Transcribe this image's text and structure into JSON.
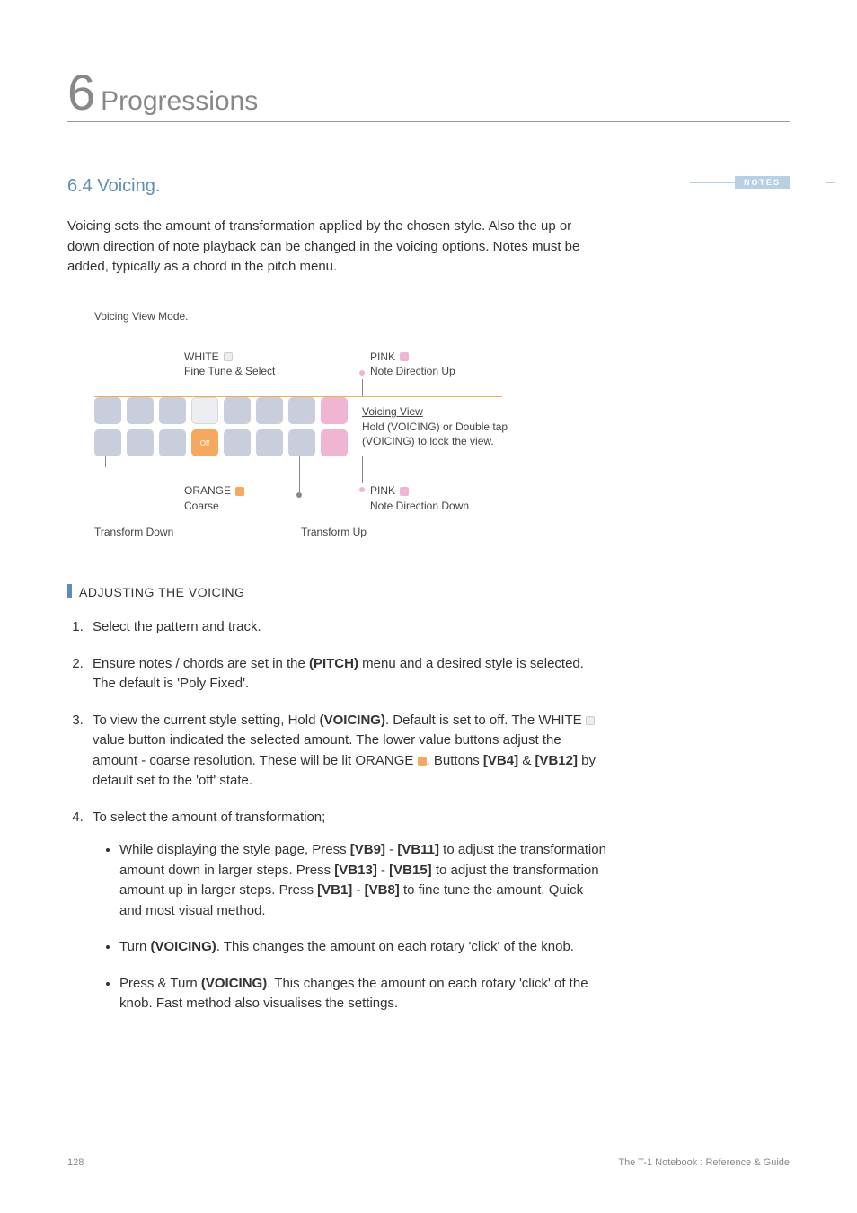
{
  "chapter": {
    "number": "6",
    "title": "Progressions"
  },
  "section": {
    "number_title": "6.4 Voicing."
  },
  "notes_label": "NOTES",
  "intro": "Voicing sets the amount of transformation applied by the chosen style. Also the up or down direction of note playback can be changed in the voicing options. Notes must be added, typically as a chord in the pitch menu.",
  "diagram": {
    "title": "Voicing View Mode.",
    "labels": {
      "white_title": "WHITE",
      "white_sub": "Fine Tune & Select",
      "pink_up_title": "PINK",
      "pink_up_sub": "Note Direction Up",
      "pink_dn_title": "PINK",
      "pink_dn_sub": "Note Direction Down",
      "orange_title": "ORANGE",
      "orange_sub": "Coarse",
      "voicing_view": "Voicing View",
      "voicing_view_sub": "Hold (VOICING) or Double tap (VOICING) to lock the view.",
      "transform_down": "Transform Down",
      "transform_up": "Transform Up",
      "off": "Off"
    },
    "colors": {
      "white": "#eceef2",
      "orange": "#f5a85e",
      "pink": "#efb6d4",
      "grey": "#c8cedc"
    }
  },
  "subheading": "ADJUSTING THE VOICING",
  "steps": {
    "s1": "Select the pattern and track.",
    "s2a": "Ensure notes / chords are set in the ",
    "s2b": "(PITCH)",
    "s2c": " menu and a desired style is selected. The default is 'Poly Fixed'.",
    "s3a": "To view the current style setting, Hold ",
    "s3b": "(VOICING)",
    "s3c": ".  Default is set to off. The WHITE ",
    "s3d": " value button indicated the selected amount. The lower value buttons adjust the amount - coarse resolution. These will be lit ORANGE ",
    "s3e": ". Buttons ",
    "s3f": "[VB4]",
    "s3g": " & ",
    "s3h": "[VB12]",
    "s3i": " by default set to the 'off' state.",
    "s4": "To select the amount of transformation;",
    "s4_1a": "While displaying the style page, Press ",
    "s4_1b": "[VB9]",
    "s4_1c": " - ",
    "s4_1d": "[VB11]",
    "s4_1e": " to adjust the transformation amount down in larger steps. Press ",
    "s4_1f": "[VB13]",
    "s4_1g": " - ",
    "s4_1h": "[VB15]",
    "s4_1i": " to adjust the transformation amount up in larger steps. Press ",
    "s4_1j": "[VB1]",
    "s4_1k": " - ",
    "s4_1l": "[VB8]",
    "s4_1m": " to fine tune the amount. Quick and most visual method.",
    "s4_2a": "Turn ",
    "s4_2b": "(VOICING)",
    "s4_2c": ". This changes the amount on each rotary 'click' of the knob.",
    "s4_3a": "Press & Turn ",
    "s4_3b": "(VOICING)",
    "s4_3c": ". This changes the amount on each rotary 'click' of the knob. Fast method also visualises the settings."
  },
  "footer": {
    "page": "128",
    "book": "The T-1 Notebook : Reference & Guide"
  }
}
